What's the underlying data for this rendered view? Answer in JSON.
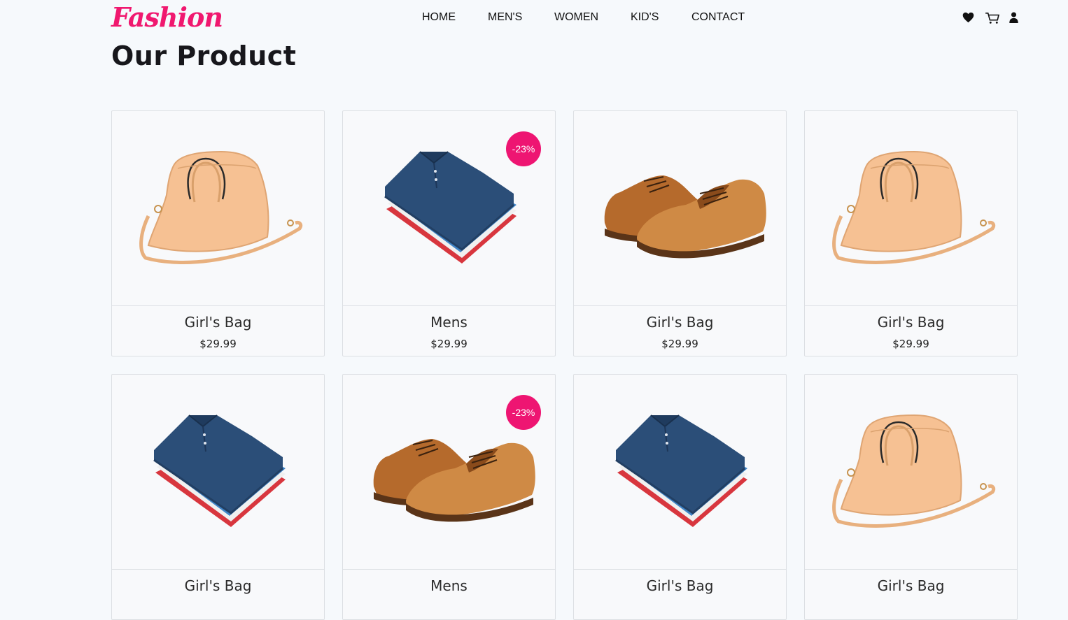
{
  "brand": {
    "logo": "Fashion"
  },
  "nav": {
    "items": [
      "HOME",
      "MEN'S",
      "WOMEN",
      "KID'S",
      "CONTACT"
    ],
    "icons": [
      "heart-icon",
      "cart-icon",
      "user-icon"
    ]
  },
  "page": {
    "title": "Our Product"
  },
  "colors": {
    "accent": "#ee1572",
    "background": "#f6f9fc",
    "border": "#dcdfe3"
  },
  "products": [
    {
      "name": "Girl's Bag",
      "price": "$29.99",
      "image": "bag",
      "badge": ""
    },
    {
      "name": "Mens",
      "price": "$29.99",
      "image": "shirts",
      "badge": "-23%"
    },
    {
      "name": "Girl's Bag",
      "price": "$29.99",
      "image": "shoes",
      "badge": ""
    },
    {
      "name": "Girl's Bag",
      "price": "$29.99",
      "image": "bag",
      "badge": ""
    },
    {
      "name": "Girl's Bag",
      "price": "",
      "image": "shirts",
      "badge": ""
    },
    {
      "name": "Mens",
      "price": "",
      "image": "shoes",
      "badge": "-23%"
    },
    {
      "name": "Girl's Bag",
      "price": "",
      "image": "shirts",
      "badge": ""
    },
    {
      "name": "Girl's Bag",
      "price": "",
      "image": "bag",
      "badge": ""
    }
  ]
}
